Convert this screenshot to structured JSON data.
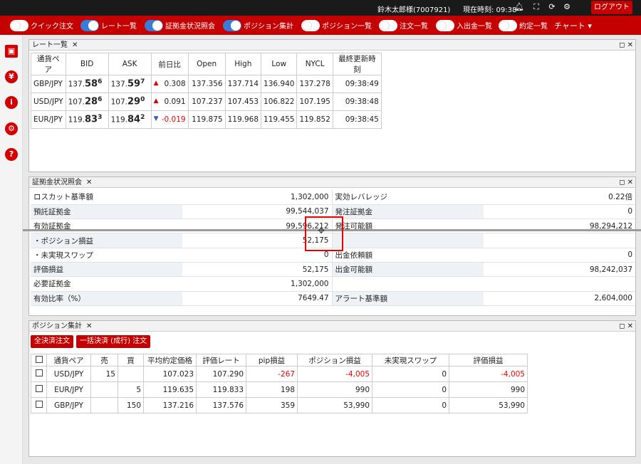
{
  "header": {
    "user": "鈴木太郎様(7007921)",
    "time": "現在時刻: 09:38",
    "logout": "ログアウト"
  },
  "nav": {
    "items": [
      {
        "label": "クイック注文",
        "on": false
      },
      {
        "label": "レート一覧",
        "on": true
      },
      {
        "label": "証拠金状況照会",
        "on": true
      },
      {
        "label": "ポジション集計",
        "on": true
      },
      {
        "label": "ポジション一覧",
        "on": false
      },
      {
        "label": "注文一覧",
        "on": false
      },
      {
        "label": "入出金一覧",
        "on": false
      },
      {
        "label": "約定一覧",
        "on": false
      }
    ],
    "chart": "チャート"
  },
  "rate_panel": {
    "title": "レート一覧",
    "headers": [
      "通貨ペア",
      "BID",
      "ASK",
      "前日比",
      "Open",
      "High",
      "Low",
      "NYCL",
      "最終更新時刻"
    ],
    "rows": [
      {
        "pair": "GBP/JPY",
        "bid_pre": "137.",
        "bid_big": "58",
        "bid_sup": "6",
        "ask_pre": "137.",
        "ask_big": "59",
        "ask_sup": "7",
        "dir": "up",
        "change": "0.308",
        "open": "137.356",
        "high": "137.714",
        "low": "136.940",
        "nycl": "137.278",
        "time": "09:38:49"
      },
      {
        "pair": "USD/JPY",
        "bid_pre": "107.",
        "bid_big": "28",
        "bid_sup": "6",
        "ask_pre": "107.",
        "ask_big": "29",
        "ask_sup": "0",
        "dir": "up",
        "change": "0.091",
        "open": "107.237",
        "high": "107.453",
        "low": "106.822",
        "nycl": "107.195",
        "time": "09:38:48"
      },
      {
        "pair": "EUR/JPY",
        "bid_pre": "119.",
        "bid_big": "83",
        "bid_sup": "3",
        "ask_pre": "119.",
        "ask_big": "84",
        "ask_sup": "2",
        "dir": "down",
        "change": "-0.019",
        "open": "119.875",
        "high": "119.968",
        "low": "119.455",
        "nycl": "119.852",
        "time": "09:38:45"
      }
    ]
  },
  "margin_panel": {
    "title": "証拠金状況照会",
    "rows": [
      [
        "ロスカット基準額",
        "1,302,000",
        "実効レバレッジ",
        "0.22倍"
      ],
      [
        "預託証拠金",
        "99,544,037",
        "発注証拠金",
        "0"
      ],
      [
        "有効証拠金",
        "99,596,212",
        "発注可能額",
        "98,294,212"
      ],
      [
        "・ポジション損益",
        "52,175",
        "",
        ""
      ],
      [
        "・未実現スワップ",
        "0",
        "出金依頼額",
        "0"
      ],
      [
        "評価損益",
        "52,175",
        "出金可能額",
        "98,242,037"
      ],
      [
        "必要証拠金",
        "1,302,000",
        "",
        ""
      ],
      [
        "有効比率（%）",
        "7649.47",
        "アラート基準額",
        "2,604,000"
      ]
    ]
  },
  "position_panel": {
    "title": "ポジション集計",
    "btn_all": "全決済注文",
    "btn_bulk": "一括決済 (成行) 注文",
    "headers": [
      "通貨ペア",
      "売",
      "買",
      "平均約定価格",
      "評価レート",
      "pip損益",
      "ポジション損益",
      "未実現スワップ",
      "評価損益"
    ],
    "rows": [
      {
        "pair": "USD/JPY",
        "sell": "15",
        "buy": "",
        "avg": "107.023",
        "rate": "107.290",
        "pip": "-267",
        "pl": "-4,005",
        "swap": "0",
        "eval": "-4,005",
        "neg": true
      },
      {
        "pair": "EUR/JPY",
        "sell": "",
        "buy": "5",
        "avg": "119.635",
        "rate": "119.833",
        "pip": "198",
        "pl": "990",
        "swap": "0",
        "eval": "990",
        "neg": false
      },
      {
        "pair": "GBP/JPY",
        "sell": "",
        "buy": "150",
        "avg": "137.216",
        "rate": "137.576",
        "pip": "359",
        "pl": "53,990",
        "swap": "0",
        "eval": "53,990",
        "neg": false
      }
    ]
  },
  "colors": {
    "brand": "#c40000",
    "toggle_on": "#3a7bd5"
  }
}
